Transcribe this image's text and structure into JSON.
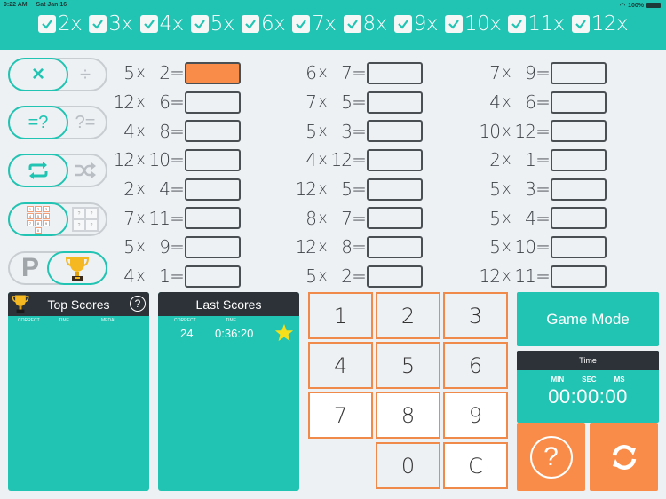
{
  "status_bar": {
    "time": "9:22 AM",
    "date": "Sat Jan 16",
    "battery": "100%"
  },
  "tables": [
    {
      "label": "2x",
      "checked": true
    },
    {
      "label": "3x",
      "checked": true
    },
    {
      "label": "4x",
      "checked": true
    },
    {
      "label": "5x",
      "checked": true
    },
    {
      "label": "6x",
      "checked": true
    },
    {
      "label": "7x",
      "checked": true
    },
    {
      "label": "8x",
      "checked": true
    },
    {
      "label": "9x",
      "checked": true
    },
    {
      "label": "10x",
      "checked": true
    },
    {
      "label": "11x",
      "checked": true
    },
    {
      "label": "12x",
      "checked": true
    }
  ],
  "toggles": {
    "operation": {
      "on": "×",
      "off": "÷",
      "selected": "multiply"
    },
    "question_type": {
      "on": "=?",
      "off": "?=",
      "selected": "answer"
    },
    "order": {
      "on": "repeat-icon",
      "off": "shuffle-icon",
      "selected": "sequential"
    },
    "input": {
      "on": "keypad",
      "off": "multiple-choice",
      "selected": "keypad",
      "keypad_digits": [
        "1",
        "2",
        "3",
        "4",
        "5",
        "6",
        "7",
        "8",
        "9",
        "0"
      ],
      "choice_marks": [
        "?",
        "?",
        "?",
        "?"
      ]
    },
    "mode": {
      "off": "P",
      "on": "trophy-icon",
      "selected": "trophy"
    }
  },
  "problems": {
    "col1": [
      {
        "a": "5",
        "b": "2",
        "active": true
      },
      {
        "a": "12",
        "b": "6"
      },
      {
        "a": "4",
        "b": "8"
      },
      {
        "a": "12",
        "b": "10"
      },
      {
        "a": "2",
        "b": "4"
      },
      {
        "a": "7",
        "b": "11"
      },
      {
        "a": "5",
        "b": "9"
      },
      {
        "a": "4",
        "b": "1"
      }
    ],
    "col2": [
      {
        "a": "6",
        "b": "7"
      },
      {
        "a": "7",
        "b": "5"
      },
      {
        "a": "5",
        "b": "3"
      },
      {
        "a": "4",
        "b": "12"
      },
      {
        "a": "12",
        "b": "5"
      },
      {
        "a": "8",
        "b": "7"
      },
      {
        "a": "12",
        "b": "8"
      },
      {
        "a": "5",
        "b": "2"
      }
    ],
    "col3": [
      {
        "a": "7",
        "b": "9"
      },
      {
        "a": "4",
        "b": "6"
      },
      {
        "a": "10",
        "b": "12"
      },
      {
        "a": "2",
        "b": "1"
      },
      {
        "a": "5",
        "b": "3"
      },
      {
        "a": "5",
        "b": "4"
      },
      {
        "a": "5",
        "b": "10"
      },
      {
        "a": "12",
        "b": "11"
      }
    ],
    "times_symbol": "x",
    "equals_symbol": "="
  },
  "top_scores": {
    "title": "Top Scores",
    "columns": [
      "CORRECT",
      "TIME",
      "MEDAL"
    ],
    "help": "?"
  },
  "last_scores": {
    "title": "Last Scores",
    "columns": [
      "CORRECT",
      "TIME"
    ],
    "row": {
      "correct": "24",
      "time": "0:36:20",
      "medal": "star"
    }
  },
  "keypad": [
    "1",
    "2",
    "3",
    "4",
    "5",
    "6",
    "7",
    "8",
    "9",
    "0",
    "C"
  ],
  "game_mode": {
    "label": "Game Mode"
  },
  "timer": {
    "title": "Time",
    "labels": [
      "MIN",
      "SEC",
      "MS"
    ],
    "value": "00:00:00"
  },
  "actions": {
    "help": "?",
    "reset": "refresh-icon"
  },
  "colors": {
    "accent": "#21c4b2",
    "orange": "#fa8c4a",
    "dark": "#2d3238",
    "background": "#eef1f4"
  }
}
